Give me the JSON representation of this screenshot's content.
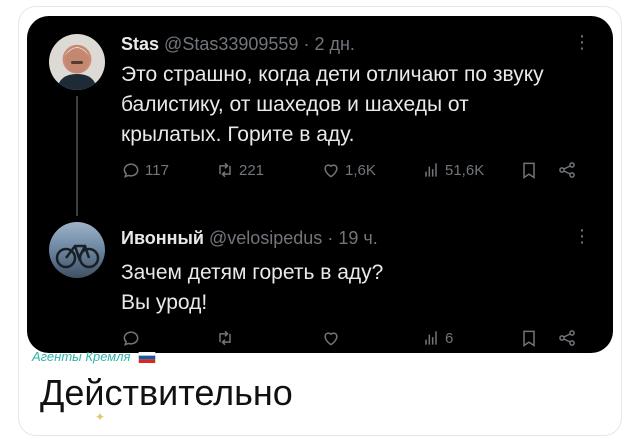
{
  "tweets": [
    {
      "name": "Stas",
      "handle": "@Stas33909559",
      "time": "· 2 дн.",
      "text_lines": [
        "Это страшно, когда дети отличают по звуку",
        "балистику, от шахедов и шахеды от",
        "крылатых. Горите в аду."
      ],
      "replies": "117",
      "reposts": "221",
      "likes": "1,6K",
      "views": "51,6K"
    },
    {
      "name": "Ивонный",
      "handle": "@velosipedus",
      "time": "· 19 ч.",
      "text_lines": [
        "Зачем детям гореть в аду?",
        "Вы урод!"
      ],
      "replies": "",
      "reposts": "",
      "likes": "",
      "views": "6"
    }
  ],
  "watermark": "Агенты Кремля",
  "caption": "Действительно",
  "more_glyph": "⋮",
  "colors": {
    "card_bg": "#000000",
    "text": "#e7e9ea",
    "muted": "#71767b",
    "watermark": "#2fb5a8"
  }
}
